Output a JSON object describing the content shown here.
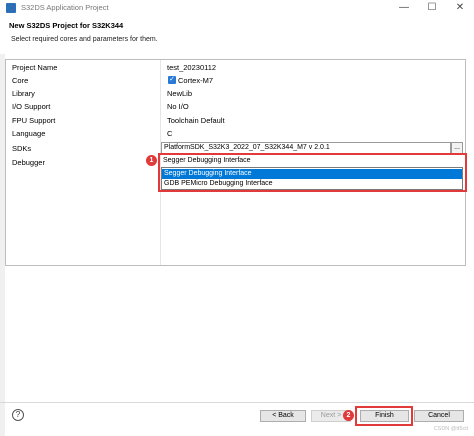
{
  "window": {
    "title": "S32DS Application Project",
    "minimize": "—",
    "maximize": "☐",
    "close": "✕"
  },
  "dialog": {
    "title": "New S32DS Project for S32K344",
    "description": "Select required cores and parameters for them."
  },
  "rows": [
    {
      "label": "Project Name",
      "value": "test_20230112"
    },
    {
      "label": "Core",
      "value": "Cortex-M7"
    },
    {
      "label": "Library",
      "value": "NewLib"
    },
    {
      "label": "I/O Support",
      "value": "No I/O"
    },
    {
      "label": "FPU Support",
      "value": "Toolchain Default"
    },
    {
      "label": "Language",
      "value": "C"
    },
    {
      "label": "SDKs",
      "value": "PlatformSDK_S32K3_2022_07_S32K344_M7 v 2.0.1"
    },
    {
      "label": "Debugger",
      "value": "Segger Debugging Interface"
    }
  ],
  "sdk_browse_label": "...",
  "debugger_options": [
    "Segger Debugging Interface",
    "GDB PEMicro Debugging Interface"
  ],
  "debugger_selected_index": 0,
  "markers": [
    "1",
    "2"
  ],
  "buttons": {
    "help": "?",
    "back": "< Back",
    "next": "Next >",
    "finish": "Finish",
    "cancel": "Cancel"
  },
  "watermark": "CSDN @tt5cit",
  "colors": {
    "accent": "#0078d7",
    "highlight": "#e23a3a",
    "checkbox": "#2b79d6"
  },
  "icons": {
    "app": "s32ds-app-icon",
    "core_checked": "checkbox-checked-icon",
    "help": "help-icon"
  }
}
